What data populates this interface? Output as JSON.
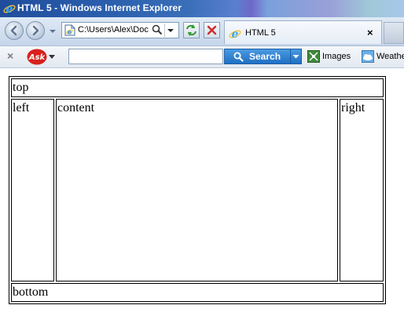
{
  "window": {
    "title": "HTML 5 - Windows Internet Explorer"
  },
  "navigation": {
    "address": "C:\\Users\\Alex\\Doc",
    "tab_label": "HTML 5",
    "tab_close": "×"
  },
  "toolbar": {
    "close_glyph": "×",
    "search_label": "Search",
    "search_value": "",
    "images_label": "Images",
    "weather_label": "Weathe"
  },
  "page": {
    "top": "top",
    "left": "left",
    "content": "content",
    "right": "right",
    "bottom": "bottom"
  },
  "colors": {
    "titlebar_accent": "#1f4d9c",
    "search_button": "#2a7fd4"
  },
  "icons": [
    "ie-icon",
    "back-arrow-icon",
    "forward-arrow-icon",
    "page-icon",
    "search-icon",
    "refresh-icon",
    "stop-icon",
    "ask-logo-icon",
    "images-icon",
    "weather-icon"
  ]
}
